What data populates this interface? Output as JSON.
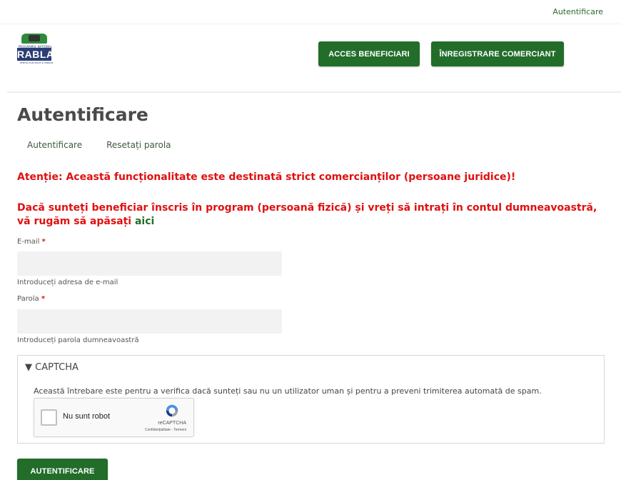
{
  "topbar": {
    "login_link": "Autentificare"
  },
  "header": {
    "logo": {
      "small_text": "PROGRAMUL NAȚIONAL",
      "main_text": "RABLA",
      "sub_text": "PENTRU ELECTRICE ȘI HIBRIDE"
    },
    "acces_button": "ACCES BENEFICIARI",
    "register_button": "ÎNREGISTRARE COMERCIANT"
  },
  "page": {
    "title": "Autentificare"
  },
  "tabs": [
    {
      "label": "Autentificare"
    },
    {
      "label": "Resetați parola"
    }
  ],
  "warnings": {
    "line1": "Atenție: Această funcționalitate este destinată strict comercianților (persoane juridice)!",
    "line2": "Dacă sunteți beneficiar înscris în program (persoană fizică) și vreți să intrați în contul dumneavoastră, vă rugăm să apăsați",
    "link": "aici"
  },
  "form": {
    "email": {
      "label": "E-mail",
      "required_mark": "*",
      "value": "",
      "help": "Introduceți adresa de e-mail"
    },
    "password": {
      "label": "Parola",
      "required_mark": "*",
      "value": "",
      "help": "Introduceți parola dumneavoastră"
    },
    "captcha": {
      "legend": "▼ CAPTCHA",
      "description": "Această întrebare este pentru a verifica dacă sunteți sau nu un utilizator uman și pentru a preveni trimiterea automată de spam.",
      "recaptcha": {
        "label": "Nu sunt robot",
        "brand": "reCAPTCHA",
        "links": "Confidențialitate - Termeni"
      }
    },
    "submit_button": "AUTENTIFICARE"
  },
  "colors": {
    "brand_green": "#226d2a",
    "warning_red": "#e01010",
    "logo_navy": "#2b3d73"
  }
}
